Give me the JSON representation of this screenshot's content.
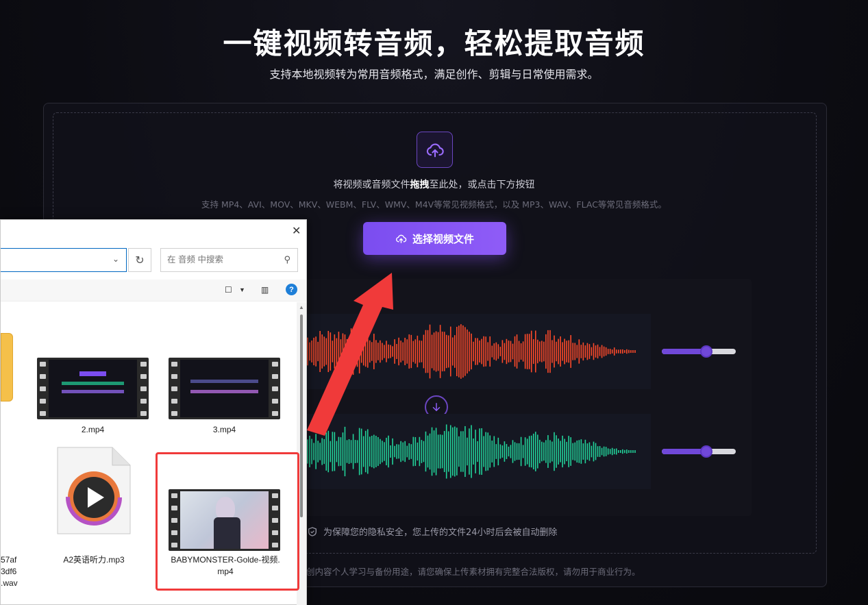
{
  "hero": {
    "title": "一键视频转音频，轻松提取音频",
    "subtitle": "支持本地视频转为常用音频格式，满足创作、剪辑与日常使用需求。"
  },
  "dropzone": {
    "hint_prefix": "将视频或音频文件",
    "hint_bold": "拖拽",
    "hint_suffix": "至此处，或点击下方按钮",
    "formats": "支持 MP4、AVI、MOV、MKV、WEBM、FLV、WMV、M4V等常见视频格式，以及 MP3、WAV、FLAC等常见音频格式。",
    "choose_button": "选择视频文件"
  },
  "preview": {
    "top_wave_color": "#ff4a2a",
    "bottom_wave_color": "#22d39a",
    "top_volume": 0.6,
    "bottom_volume": 0.6
  },
  "privacy_note": "为保障您的隐私安全，您上传的文件24小时后会被自动删除",
  "disclaimer": "创内容个人学习与备份用途，请您确保上传素材拥有完整合法版权，请勿用于商业行为。",
  "dialog": {
    "search_placeholder": "在 音频 中搜索",
    "files": [
      {
        "name": "2.mp4",
        "type": "video"
      },
      {
        "name": "3.mp4",
        "type": "video"
      },
      {
        "name_line1": "57af",
        "name_line2": "3df6",
        "name_line3": ".wav",
        "type": "partial"
      },
      {
        "name": "A2英语听力.mp3",
        "type": "audio"
      },
      {
        "name_line1": "BABYMONSTER-Golde-视频.",
        "name_line2": "mp4",
        "type": "video"
      }
    ]
  },
  "colors": {
    "accent": "#7b4df0",
    "arrow": "#f03a3a"
  }
}
